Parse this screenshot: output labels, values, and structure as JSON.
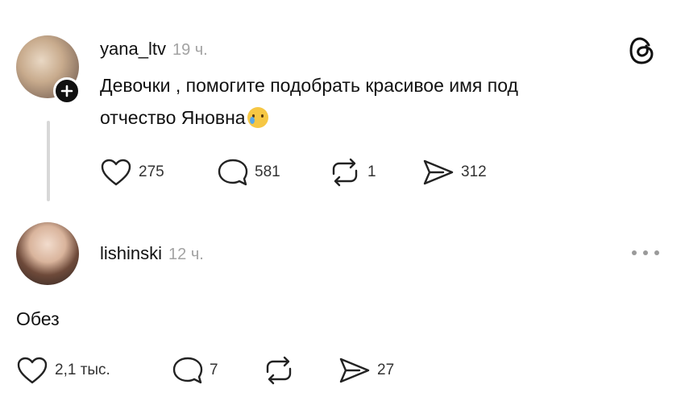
{
  "post": {
    "username": "yana_ltv",
    "time": "19 ч.",
    "text_line1": "Девочки , помогите подобрать красивое имя под",
    "text_line2": "отчество Яновна",
    "stats": {
      "likes": "275",
      "comments": "581",
      "reposts": "1",
      "shares": "312"
    }
  },
  "reply": {
    "username": "lishinski",
    "time": "12 ч.",
    "text": "Обез",
    "stats": {
      "likes": "2,1 тыс.",
      "comments": "7",
      "reposts": "",
      "shares": "27"
    }
  },
  "icons": [
    "threads-logo-icon",
    "plus-icon",
    "heart-icon",
    "comment-icon",
    "repost-icon",
    "share-icon",
    "more-icon"
  ],
  "colors": {
    "text": "#111111",
    "muted": "#a3a3a3",
    "line": "#d8d8d8",
    "background": "#ffffff"
  }
}
